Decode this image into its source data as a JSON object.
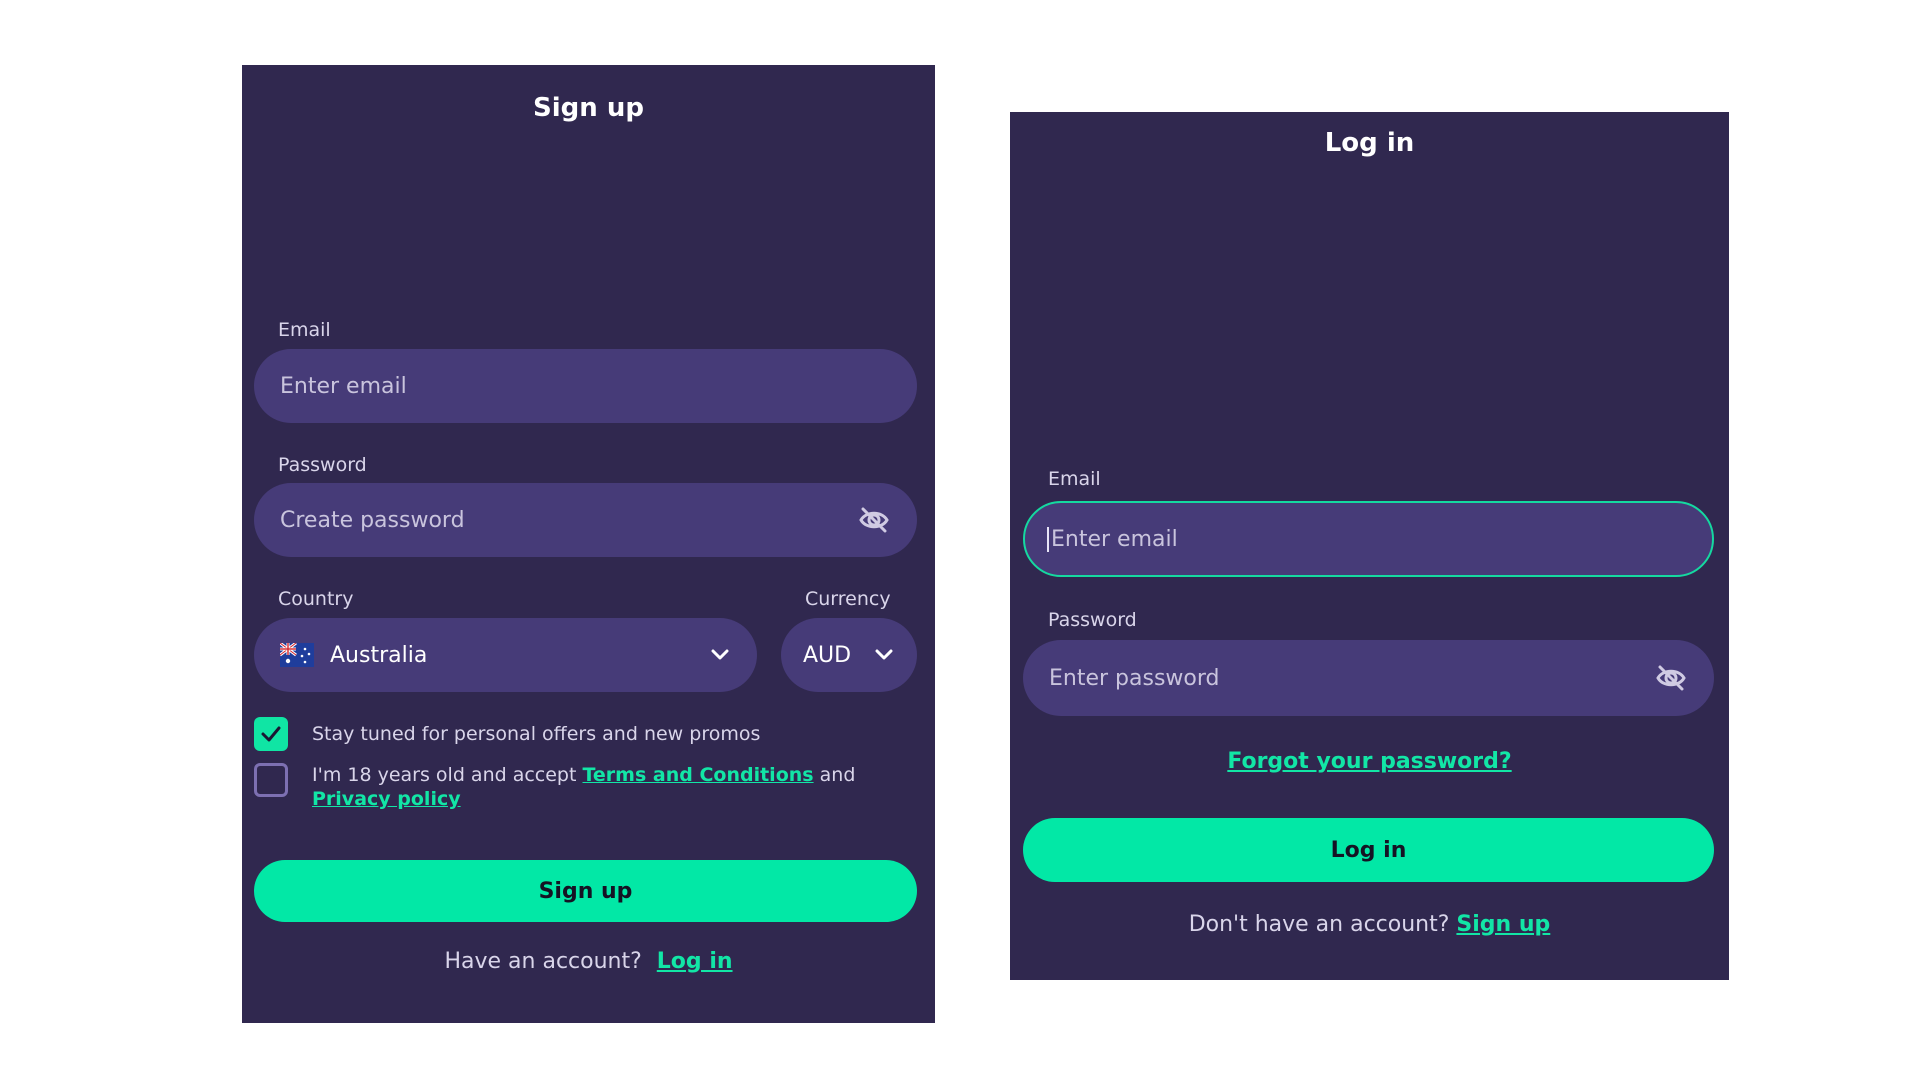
{
  "signup": {
    "title": "Sign up",
    "email_label": "Email",
    "email_placeholder": "Enter email",
    "password_label": "Password",
    "password_placeholder": "Create password",
    "country_label": "Country",
    "country_value": "Australia",
    "currency_label": "Currency",
    "currency_value": "AUD",
    "promo_text": "Stay tuned for personal offers and new promos",
    "promo_checked": true,
    "terms_prefix": "I'm 18 years old and accept ",
    "terms_link": "Terms and Conditions",
    "terms_and": " and ",
    "privacy_link": "Privacy policy",
    "terms_checked": false,
    "submit_label": "Sign up",
    "footer_text": "Have an account?",
    "footer_link": "Log in"
  },
  "login": {
    "title": "Log in",
    "email_label": "Email",
    "email_placeholder": "Enter email",
    "password_label": "Password",
    "password_placeholder": "Enter password",
    "forgot_link": "Forgot your password?",
    "submit_label": "Log in",
    "footer_text": "Don't have an account?",
    "footer_link": "Sign up"
  },
  "icons": {
    "password_toggle": "eye-off-icon",
    "country_flag": "australia-flag-icon",
    "dropdown": "chevron-down-icon",
    "check": "checkmark-icon"
  },
  "colors": {
    "panel_bg": "#30284f",
    "input_bg": "#463b78",
    "accent": "#02e8a6",
    "text_light": "#d9d5ea"
  }
}
